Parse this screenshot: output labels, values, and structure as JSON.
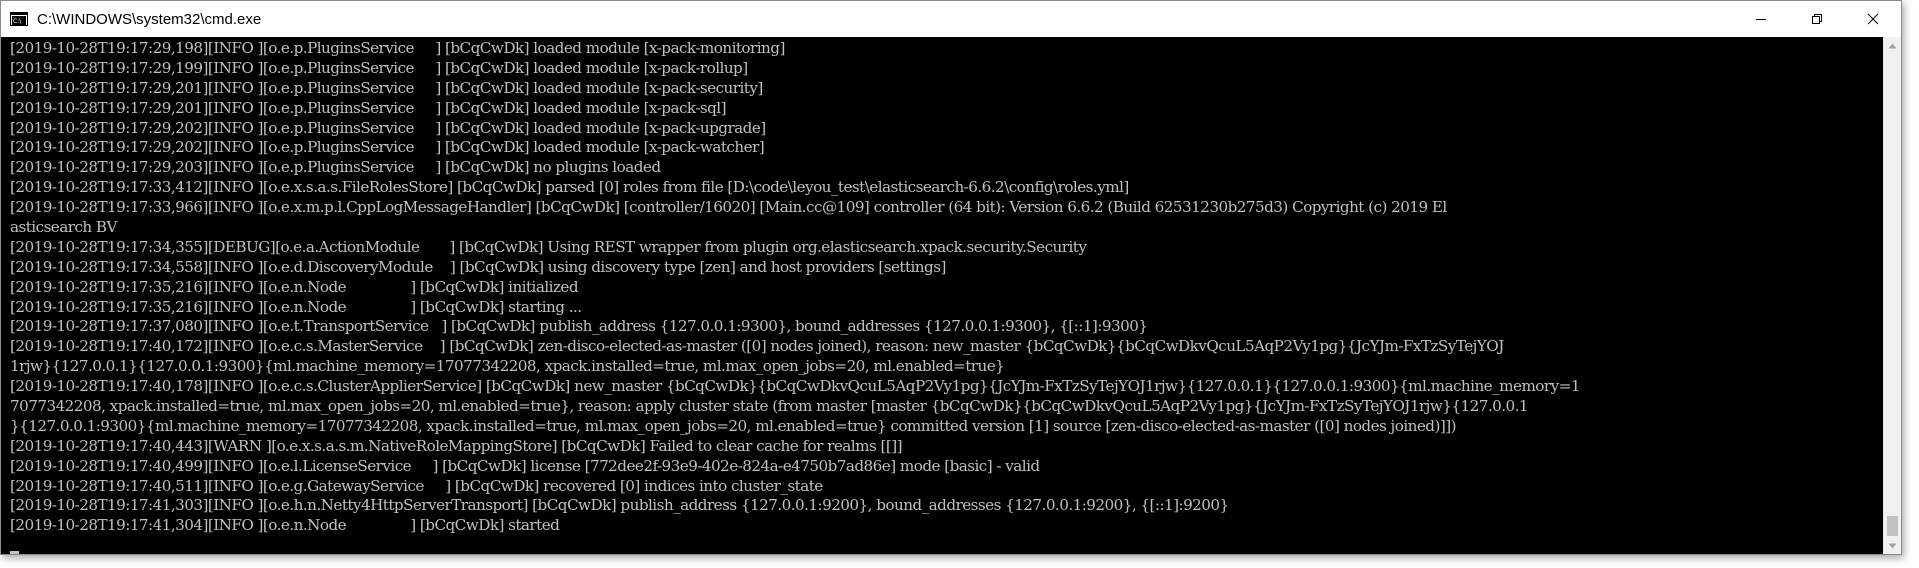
{
  "window": {
    "title": "C:\\WINDOWS\\system32\\cmd.exe",
    "icon": "cmd-icon",
    "controls": [
      "minimize-icon",
      "maximize-icon",
      "close-icon"
    ]
  },
  "colors": {
    "console_bg": "#000000",
    "console_text": "#c0c0c0",
    "titlebar_bg": "#ffffff"
  },
  "console": {
    "lines": [
      "[2019-10-28T19:17:29,198][INFO ][o.e.p.PluginsService     ] [bCqCwDk] loaded module [x-pack-monitoring]",
      "[2019-10-28T19:17:29,199][INFO ][o.e.p.PluginsService     ] [bCqCwDk] loaded module [x-pack-rollup]",
      "[2019-10-28T19:17:29,201][INFO ][o.e.p.PluginsService     ] [bCqCwDk] loaded module [x-pack-security]",
      "[2019-10-28T19:17:29,201][INFO ][o.e.p.PluginsService     ] [bCqCwDk] loaded module [x-pack-sql]",
      "[2019-10-28T19:17:29,202][INFO ][o.e.p.PluginsService     ] [bCqCwDk] loaded module [x-pack-upgrade]",
      "[2019-10-28T19:17:29,202][INFO ][o.e.p.PluginsService     ] [bCqCwDk] loaded module [x-pack-watcher]",
      "[2019-10-28T19:17:29,203][INFO ][o.e.p.PluginsService     ] [bCqCwDk] no plugins loaded",
      "[2019-10-28T19:17:33,412][INFO ][o.e.x.s.a.s.FileRolesStore] [bCqCwDk] parsed [0] roles from file [D:\\code\\leyou_test\\elasticsearch-6.6.2\\config\\roles.yml]",
      "[2019-10-28T19:17:33,966][INFO ][o.e.x.m.p.l.CppLogMessageHandler] [bCqCwDk] [controller/16020] [Main.cc@109] controller (64 bit): Version 6.6.2 (Build 62531230b275d3) Copyright (c) 2019 El",
      "asticsearch BV",
      "[2019-10-28T19:17:34,355][DEBUG][o.e.a.ActionModule       ] [bCqCwDk] Using REST wrapper from plugin org.elasticsearch.xpack.security.Security",
      "[2019-10-28T19:17:34,558][INFO ][o.e.d.DiscoveryModule    ] [bCqCwDk] using discovery type [zen] and host providers [settings]",
      "[2019-10-28T19:17:35,216][INFO ][o.e.n.Node               ] [bCqCwDk] initialized",
      "[2019-10-28T19:17:35,216][INFO ][o.e.n.Node               ] [bCqCwDk] starting ...",
      "[2019-10-28T19:17:37,080][INFO ][o.e.t.TransportService   ] [bCqCwDk] publish_address {127.0.0.1:9300}, bound_addresses {127.0.0.1:9300}, {[::1]:9300}",
      "[2019-10-28T19:17:40,172][INFO ][o.e.c.s.MasterService    ] [bCqCwDk] zen-disco-elected-as-master ([0] nodes joined), reason: new_master {bCqCwDk}{bCqCwDkvQcuL5AqP2Vy1pg}{JcYJm-FxTzSyTejYOJ",
      "1rjw}{127.0.0.1}{127.0.0.1:9300}{ml.machine_memory=17077342208, xpack.installed=true, ml.max_open_jobs=20, ml.enabled=true}",
      "[2019-10-28T19:17:40,178][INFO ][o.e.c.s.ClusterApplierService] [bCqCwDk] new_master {bCqCwDk}{bCqCwDkvQcuL5AqP2Vy1pg}{JcYJm-FxTzSyTejYOJ1rjw}{127.0.0.1}{127.0.0.1:9300}{ml.machine_memory=1",
      "7077342208, xpack.installed=true, ml.max_open_jobs=20, ml.enabled=true}, reason: apply cluster state (from master [master {bCqCwDk}{bCqCwDkvQcuL5AqP2Vy1pg}{JcYJm-FxTzSyTejYOJ1rjw}{127.0.0.1",
      "}{127.0.0.1:9300}{ml.machine_memory=17077342208, xpack.installed=true, ml.max_open_jobs=20, ml.enabled=true} committed version [1] source [zen-disco-elected-as-master ([0] nodes joined)]])",
      "[2019-10-28T19:17:40,443][WARN ][o.e.x.s.a.s.m.NativeRoleMappingStore] [bCqCwDk] Failed to clear cache for realms [[]]",
      "[2019-10-28T19:17:40,499][INFO ][o.e.l.LicenseService     ] [bCqCwDk] license [772dee2f-93e9-402e-824a-e4750b7ad86e] mode [basic] - valid",
      "[2019-10-28T19:17:40,511][INFO ][o.e.g.GatewayService     ] [bCqCwDk] recovered [0] indices into cluster_state",
      "[2019-10-28T19:17:41,303][INFO ][o.e.h.n.Netty4HttpServerTransport] [bCqCwDk] publish_address {127.0.0.1:9200}, bound_addresses {127.0.0.1:9200}, {[::1]:9200}",
      "[2019-10-28T19:17:41,304][INFO ][o.e.n.Node               ] [bCqCwDk] started"
    ]
  }
}
